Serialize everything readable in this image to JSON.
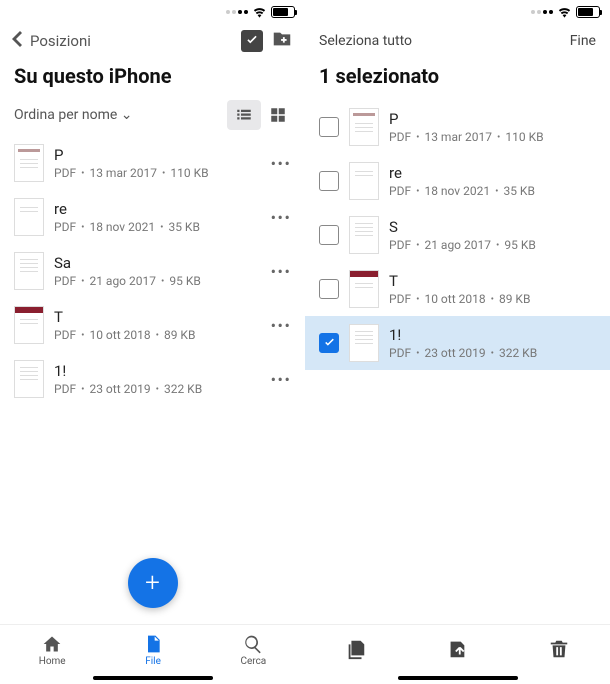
{
  "left": {
    "back_label": "Posizioni",
    "title": "Su questo iPhone",
    "sort_label": "Ordina per nome",
    "tabs": {
      "home": "Home",
      "file": "File",
      "cerca": "Cerca"
    },
    "fab_glyph": "+",
    "items": [
      {
        "name": "P",
        "type": "PDF",
        "date": "13 mar 2017",
        "size": "110 KB",
        "thumb": "bar"
      },
      {
        "name": "re",
        "type": "PDF",
        "date": "18 nov 2021",
        "size": "35 KB",
        "thumb": "plain"
      },
      {
        "name": "Sa",
        "type": "PDF",
        "date": "21 ago 2017",
        "size": "95 KB",
        "thumb": "lines"
      },
      {
        "name": "T",
        "type": "PDF",
        "date": "10 ott 2018",
        "size": "89 KB",
        "thumb": "red"
      },
      {
        "name": "1!",
        "type": "PDF",
        "date": "23 ott 2019",
        "size": "322 KB",
        "thumb": "lines"
      }
    ]
  },
  "right": {
    "select_all_label": "Seleziona tutto",
    "done_label": "Fine",
    "title": "1 selezionato",
    "items": [
      {
        "name": "P",
        "type": "PDF",
        "date": "13 mar 2017",
        "size": "110 KB",
        "thumb": "bar",
        "checked": false
      },
      {
        "name": "re",
        "type": "PDF",
        "date": "18 nov 2021",
        "size": "35 KB",
        "thumb": "plain",
        "checked": false
      },
      {
        "name": "S",
        "type": "PDF",
        "date": "21 ago 2017",
        "size": "95 KB",
        "thumb": "lines",
        "checked": false
      },
      {
        "name": "T",
        "type": "PDF",
        "date": "10 ott 2018",
        "size": "89 KB",
        "thumb": "red",
        "checked": false
      },
      {
        "name": "1!",
        "type": "PDF",
        "date": "23 ott 2019",
        "size": "322 KB",
        "thumb": "lines",
        "checked": true
      }
    ]
  }
}
